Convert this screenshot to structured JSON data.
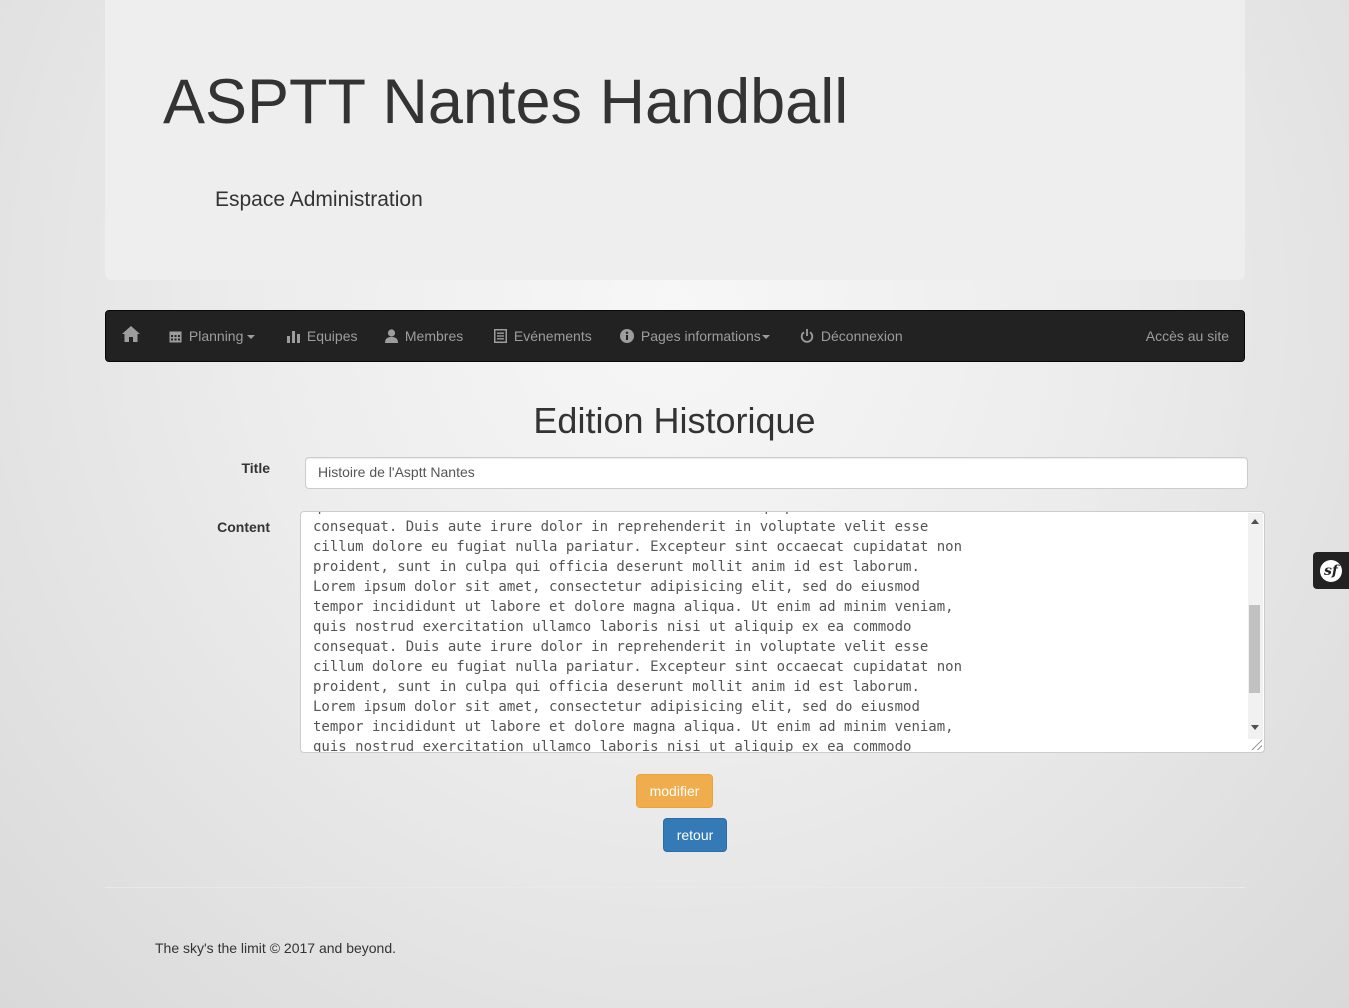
{
  "header": {
    "title": "ASPTT Nantes Handball",
    "subtitle": "Espace Administration"
  },
  "navbar": {
    "items": [
      {
        "icon": "home-icon"
      },
      {
        "label": "Planning",
        "icon": "calendar-icon",
        "dropdown": true
      },
      {
        "label": "Equipes",
        "icon": "bar-chart-icon"
      },
      {
        "label": "Membres",
        "icon": "user-icon"
      },
      {
        "label": "Evénements",
        "icon": "list-icon"
      },
      {
        "label": "Pages informations",
        "icon": "info-icon",
        "dropdown": true
      },
      {
        "label": "Déconnexion",
        "icon": "power-icon"
      }
    ],
    "right_link": "Accès au site",
    "background": "#222222"
  },
  "form": {
    "heading": "Edition Historique",
    "title_label": "Title",
    "title_value": "Histoire de l'Asptt Nantes",
    "content_label": "Content",
    "content_value": "quis nostrud exercitation ullamco laboris nisi ut aliquip ex ea commodo\nconsequat. Duis aute irure dolor in reprehenderit in voluptate velit esse\ncillum dolore eu fugiat nulla pariatur. Excepteur sint occaecat cupidatat non\nproident, sunt in culpa qui officia deserunt mollit anim id est laborum.\nLorem ipsum dolor sit amet, consectetur adipisicing elit, sed do eiusmod\ntempor incididunt ut labore et dolore magna aliqua. Ut enim ad minim veniam,\nquis nostrud exercitation ullamco laboris nisi ut aliquip ex ea commodo\nconsequat. Duis aute irure dolor in reprehenderit in voluptate velit esse\ncillum dolore eu fugiat nulla pariatur. Excepteur sint occaecat cupidatat non\nproident, sunt in culpa qui officia deserunt mollit anim id est laborum.\nLorem ipsum dolor sit amet, consectetur adipisicing elit, sed do eiusmod\ntempor incididunt ut labore et dolore magna aliqua. Ut enim ad minim veniam,\nquis nostrud exercitation ullamco laboris nisi ut aliquip ex ea commodo",
    "submit_label": "modifier",
    "back_label": "retour",
    "colors": {
      "submit": "#f0ad4e",
      "back": "#337ab7"
    }
  },
  "footer": {
    "text": "The sky's the limit © 2017 and beyond."
  },
  "debug_toolbar": {
    "icon": "symfony-logo-icon",
    "glyph": "sf"
  }
}
